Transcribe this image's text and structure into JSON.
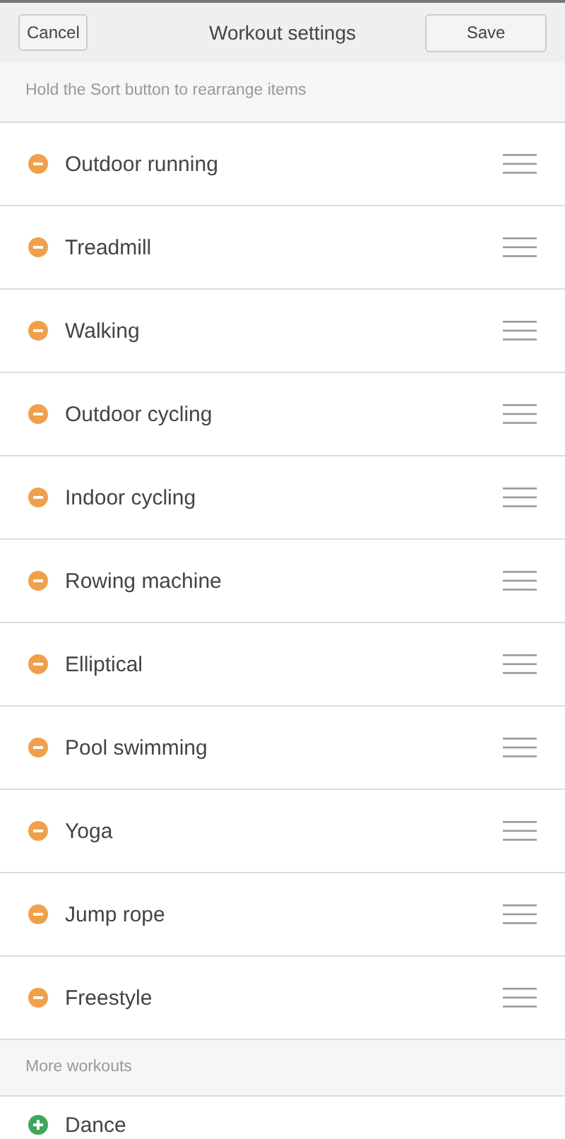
{
  "header": {
    "cancel": "Cancel",
    "title": "Workout settings",
    "save": "Save"
  },
  "hint": "Hold the Sort button to rearrange items",
  "workouts": [
    {
      "label": "Outdoor running",
      "kind": "remove"
    },
    {
      "label": "Treadmill",
      "kind": "remove"
    },
    {
      "label": "Walking",
      "kind": "remove"
    },
    {
      "label": "Outdoor cycling",
      "kind": "remove"
    },
    {
      "label": "Indoor cycling",
      "kind": "remove"
    },
    {
      "label": "Rowing machine",
      "kind": "remove"
    },
    {
      "label": "Elliptical",
      "kind": "remove"
    },
    {
      "label": "Pool swimming",
      "kind": "remove"
    },
    {
      "label": "Yoga",
      "kind": "remove"
    },
    {
      "label": "Jump rope",
      "kind": "remove"
    },
    {
      "label": "Freestyle",
      "kind": "remove"
    }
  ],
  "more_header": "More workouts",
  "more_workouts": [
    {
      "label": "Dance",
      "kind": "add"
    }
  ]
}
